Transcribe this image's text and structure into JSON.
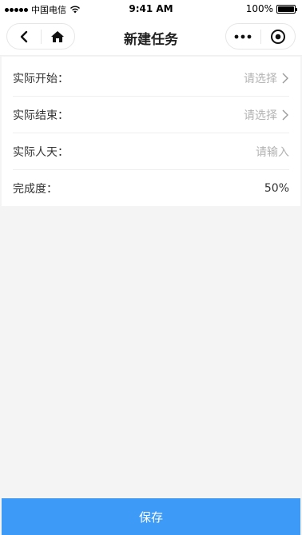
{
  "status_bar": {
    "carrier": "中国电信",
    "time": "9:41 AM",
    "battery": "100%"
  },
  "nav": {
    "title": "新建任务"
  },
  "form": {
    "rows": [
      {
        "label": "实际开始：",
        "placeholder": "请选择"
      },
      {
        "label": "实际结束：",
        "placeholder": "请选择"
      },
      {
        "label": "实际人天：",
        "placeholder": "请输入"
      },
      {
        "label": "完成度：",
        "value": "50%"
      }
    ]
  },
  "footer": {
    "save_label": "保存"
  },
  "colors": {
    "accent": "#3d9bf7",
    "page_bg": "#f4f4f4",
    "placeholder": "#b3b3b3"
  }
}
